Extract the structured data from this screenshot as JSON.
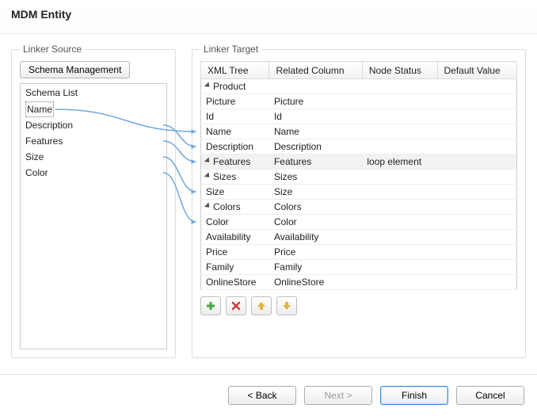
{
  "header": {
    "title": "MDM Entity"
  },
  "source": {
    "legend": "Linker Source",
    "schema_button": "Schema Management",
    "list_title": "Schema List",
    "items": [
      {
        "label": "Name",
        "selected": true
      },
      {
        "label": "Description"
      },
      {
        "label": "Features"
      },
      {
        "label": "Size"
      },
      {
        "label": "Color"
      }
    ]
  },
  "target": {
    "legend": "Linker Target",
    "columns": [
      "XML Tree",
      "Related Column",
      "Node Status",
      "Default Value"
    ],
    "rows": [
      {
        "indent": 0,
        "exp": true,
        "tree": "Product",
        "related": "",
        "status": "",
        "default": ""
      },
      {
        "indent": 1,
        "exp": false,
        "tree": "Picture",
        "related": "Picture",
        "status": "",
        "default": ""
      },
      {
        "indent": 1,
        "exp": false,
        "tree": "Id",
        "related": "Id",
        "status": "",
        "default": ""
      },
      {
        "indent": 1,
        "exp": false,
        "tree": "Name",
        "related": "Name",
        "status": "",
        "default": ""
      },
      {
        "indent": 1,
        "exp": false,
        "tree": "Description",
        "related": "Description",
        "status": "",
        "default": ""
      },
      {
        "indent": 1,
        "exp": true,
        "tree": "Features",
        "related": "Features",
        "status": "loop element",
        "default": "",
        "highlight": true
      },
      {
        "indent": 2,
        "exp": true,
        "tree": "Sizes",
        "related": "Sizes",
        "status": "",
        "default": ""
      },
      {
        "indent": 3,
        "exp": false,
        "tree": "Size",
        "related": "Size",
        "status": "",
        "default": ""
      },
      {
        "indent": 2,
        "exp": true,
        "tree": "Colors",
        "related": "Colors",
        "status": "",
        "default": ""
      },
      {
        "indent": 3,
        "exp": false,
        "tree": "Color",
        "related": "Color",
        "status": "",
        "default": ""
      },
      {
        "indent": 1,
        "exp": false,
        "tree": "Availability",
        "related": "Availability",
        "status": "",
        "default": ""
      },
      {
        "indent": 1,
        "exp": false,
        "tree": "Price",
        "related": "Price",
        "status": "",
        "default": ""
      },
      {
        "indent": 1,
        "exp": false,
        "tree": "Family",
        "related": "Family",
        "status": "",
        "default": ""
      },
      {
        "indent": 1,
        "exp": false,
        "tree": "OnlineStore",
        "related": "OnlineStore",
        "status": "",
        "default": ""
      }
    ],
    "toolbar": {
      "add": "add-icon",
      "del": "delete-icon",
      "up": "move-up-icon",
      "down": "move-down-icon"
    }
  },
  "links": [
    {
      "from": "Name",
      "to": "Name"
    },
    {
      "from": "Description",
      "to": "Description"
    },
    {
      "from": "Features",
      "to": "Features"
    },
    {
      "from": "Size",
      "to": "Size"
    },
    {
      "from": "Color",
      "to": "Color"
    }
  ],
  "footer": {
    "back": "< Back",
    "next": "Next >",
    "finish": "Finish",
    "cancel": "Cancel"
  }
}
